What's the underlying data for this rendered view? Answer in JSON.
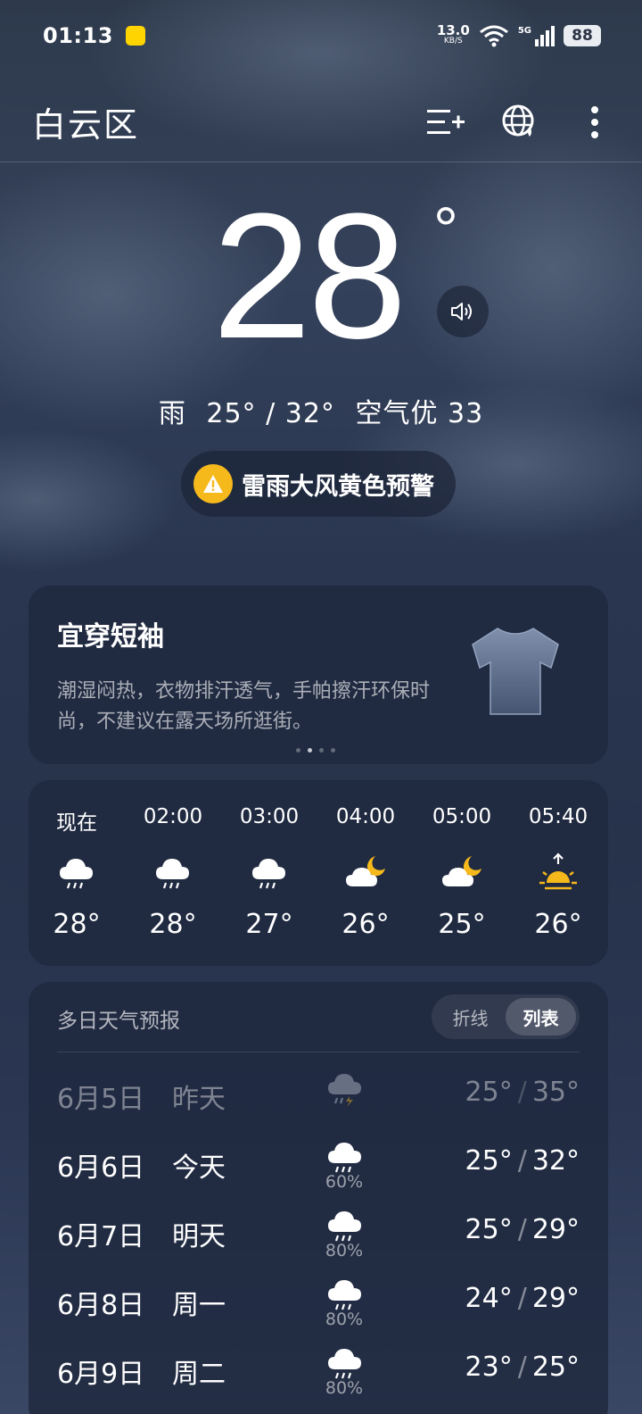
{
  "status": {
    "time": "01:13",
    "net_speed": "13.0",
    "net_unit": "KB/S",
    "network": "5G",
    "battery": "88"
  },
  "header": {
    "city": "白云区",
    "icons": [
      "add-city-icon",
      "globe-icon",
      "more-vert-icon"
    ]
  },
  "current": {
    "temp": "28",
    "degree": "°",
    "condition": "雨",
    "range": "25° / 32°",
    "air": "空气优 33",
    "alert": "雷雨大风黄色预警"
  },
  "tip": {
    "title": "宜穿短袖",
    "text": "潮湿闷热，衣物排汗透气，手帕擦汗环保时尚，不建议在露天场所逛街。",
    "page_count": 4,
    "active_page": 1
  },
  "hourly": [
    {
      "time": "现在",
      "icon": "rain-icon",
      "temp": "28°"
    },
    {
      "time": "02:00",
      "icon": "rain-icon",
      "temp": "28°"
    },
    {
      "time": "03:00",
      "icon": "rain-icon",
      "temp": "27°"
    },
    {
      "time": "04:00",
      "icon": "partly-cloudy-night-icon",
      "temp": "26°"
    },
    {
      "time": "05:00",
      "icon": "partly-cloudy-night-icon",
      "temp": "25°"
    },
    {
      "time": "05:40",
      "icon": "sunrise-icon",
      "temp": "26°"
    }
  ],
  "daily": {
    "title": "多日天气预报",
    "toggle": {
      "line": "折线",
      "list": "列表",
      "selected": "列表"
    },
    "days": [
      {
        "date": "6月5日",
        "name": "昨天",
        "icon": "thunderstorm-icon",
        "pop": "",
        "low": "25°",
        "high": "35°",
        "past": true
      },
      {
        "date": "6月6日",
        "name": "今天",
        "icon": "rain-icon",
        "pop": "60%",
        "low": "25°",
        "high": "32°",
        "past": false
      },
      {
        "date": "6月7日",
        "name": "明天",
        "icon": "rain-icon",
        "pop": "80%",
        "low": "25°",
        "high": "29°",
        "past": false
      },
      {
        "date": "6月8日",
        "name": "周一",
        "icon": "rain-icon",
        "pop": "80%",
        "low": "24°",
        "high": "29°",
        "past": false
      },
      {
        "date": "6月9日",
        "name": "周二",
        "icon": "rain-icon",
        "pop": "80%",
        "low": "23°",
        "high": "25°",
        "past": false
      }
    ]
  },
  "colors": {
    "alert": "#f6b91c",
    "sun": "#f6b91c",
    "card": "#1e283e"
  }
}
